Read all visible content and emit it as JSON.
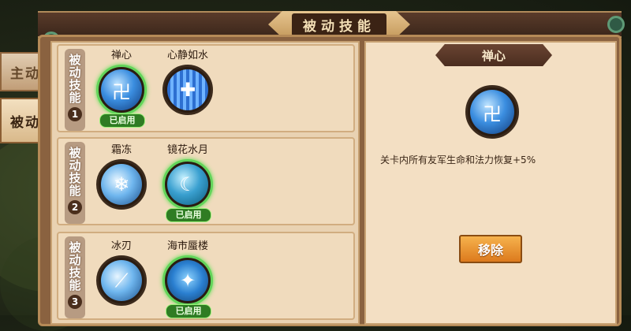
{
  "header": {
    "title": "被动技能"
  },
  "side_tabs": {
    "active": "主动",
    "passive": "被动"
  },
  "groups": [
    {
      "label": "被动技能",
      "number": "1",
      "skills": [
        {
          "name": "禅心",
          "enabled": true,
          "badge": "已启用",
          "icon": "zen-swirl-icon"
        },
        {
          "name": "心静如水",
          "enabled": false,
          "badge": "",
          "icon": "water-cross-icon"
        }
      ]
    },
    {
      "label": "被动技能",
      "number": "2",
      "skills": [
        {
          "name": "霜冻",
          "enabled": false,
          "badge": "",
          "icon": "snowflake-icon"
        },
        {
          "name": "镜花水月",
          "enabled": true,
          "badge": "已启用",
          "icon": "mirror-moon-icon"
        }
      ]
    },
    {
      "label": "被动技能",
      "number": "3",
      "skills": [
        {
          "name": "冰刃",
          "enabled": false,
          "badge": "",
          "icon": "ice-blade-icon"
        },
        {
          "name": "海市蜃楼",
          "enabled": true,
          "badge": "已启用",
          "icon": "mirage-icon"
        }
      ]
    }
  ],
  "detail": {
    "title": "禅心",
    "description": "关卡内所有友军生命和法力恢复+5%",
    "remove_label": "移除"
  },
  "colors": {
    "enabled_border": "#62d45a",
    "badge_bg": "#2f7c23",
    "button_orange": "#f6b24d"
  }
}
